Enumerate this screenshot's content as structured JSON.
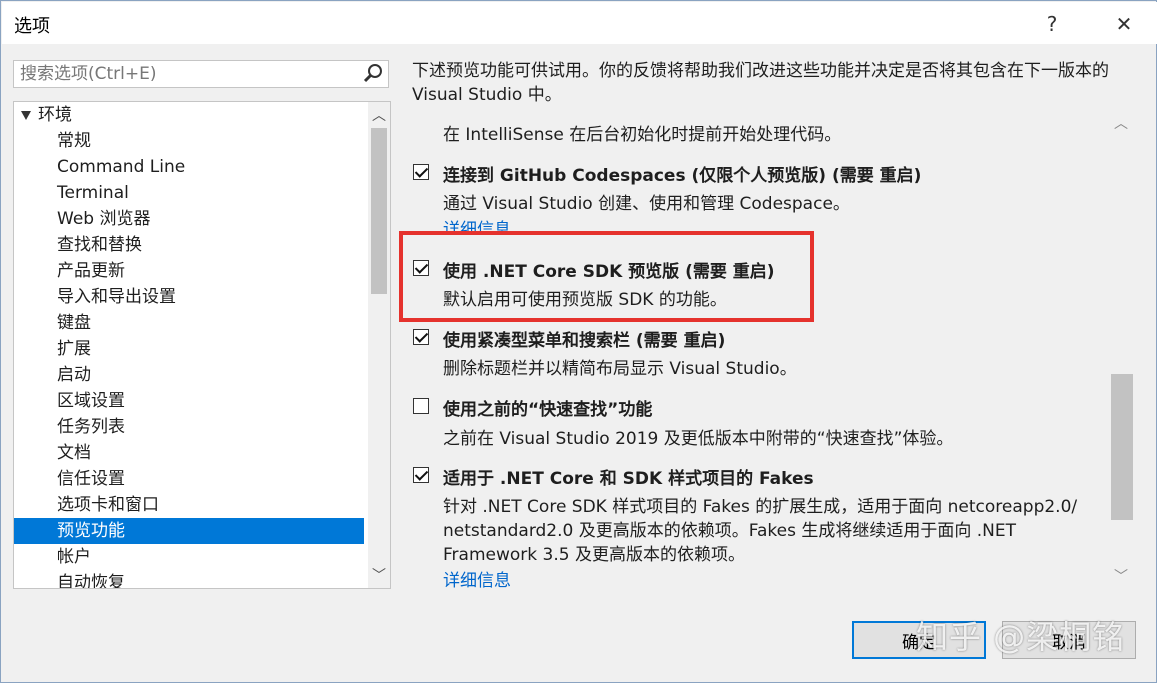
{
  "window": {
    "title": "选项",
    "help_label": "?",
    "close_label": "✕"
  },
  "search": {
    "placeholder": "搜索选项(Ctrl+E)"
  },
  "tree": {
    "root_label": "环境",
    "items": [
      "常规",
      "Command Line",
      "Terminal",
      "Web 浏览器",
      "查找和替换",
      "产品更新",
      "导入和导出设置",
      "键盘",
      "扩展",
      "启动",
      "区域设置",
      "任务列表",
      "文档",
      "信任设置",
      "选项卡和窗口",
      "预览功能",
      "帐户",
      "自动恢复"
    ],
    "selected": "预览功能"
  },
  "intro": "下述预览功能可供试用。你的反馈将帮助我们改进这些功能并决定是否将其包含在下一版本的 Visual Studio 中。",
  "features": {
    "partial_desc": "在 IntelliSense 在后台初始化时提前开始处理代码。",
    "f1": {
      "title": "连接到 GitHub Codespaces (仅限个人预览版) (需要 重启)",
      "checked": true,
      "desc": "通过 Visual Studio 创建、使用和管理 Codespace。",
      "link": "详细信息"
    },
    "f2": {
      "title": "使用 .NET Core SDK 预览版 (需要 重启)",
      "checked": true,
      "desc": "默认启用可使用预览版 SDK 的功能。"
    },
    "f3": {
      "title": "使用紧凑型菜单和搜索栏 (需要 重启)",
      "checked": true,
      "desc": "删除标题栏并以精简布局显示 Visual Studio。"
    },
    "f4": {
      "title": "使用之前的“快速查找”功能",
      "checked": false,
      "desc": "之前在 Visual Studio 2019 及更低版本中附带的“快速查找”体验。"
    },
    "f5": {
      "title": "适用于 .NET Core 和 SDK 样式项目的 Fakes",
      "checked": true,
      "desc1": "针对 .NET Core SDK 样式项目的 Fakes 的扩展生成，适用于面向 netcoreapp2.0/",
      "desc2": "netstandard2.0 及更高版本的依赖项。Fakes 生成将继续适用于面向 .NET",
      "desc3": "Framework 3.5 及更高版本的依赖项。",
      "link": "详细信息"
    }
  },
  "buttons": {
    "ok": "确定",
    "cancel": "取消"
  },
  "watermark": "知乎 @梁桐铭",
  "colors": {
    "selection": "#0078d7",
    "highlight_box": "#e5322d",
    "link": "#0066cc"
  }
}
